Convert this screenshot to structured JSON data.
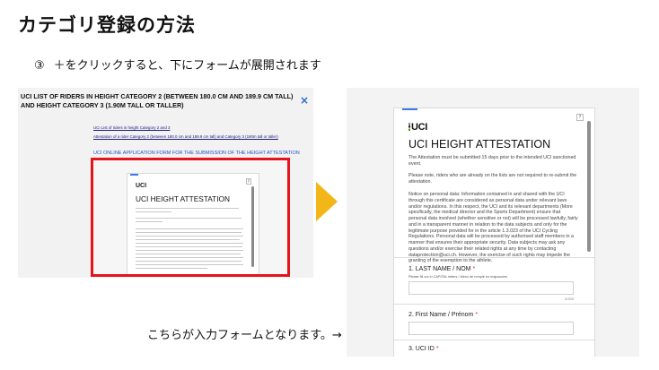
{
  "slide": {
    "title": "カテゴリ登録の方法",
    "step_number": "③",
    "step_text": "＋をクリックすると、下にフォームが展開されます",
    "caption": "こちらが入力フォームとなります。→"
  },
  "left_page": {
    "title": "UCI LIST OF RIDERS IN HEIGHT CATEGORY 2 (BETWEEN 180.0 CM AND 189.9 CM TALL) AND HEIGHT CATEGORY 3 (1.90M TALL OR TALLER)",
    "close_icon": "×",
    "link_1": "UCI List of riders in height Category 2 and 3",
    "link_2": "Attestation of a rider Category 2 (between 180.0 cm and 189.9 cm tall) and Category 3 (190m tall or taller)",
    "apply_link": "UCI ONLINE APPLICATION FORM FOR THE SUBMISSION OF THE HEIGHT ATTESTATION",
    "mini_logo": "UCI",
    "mini_title": "UCI HEIGHT ATTESTATION",
    "mini_help": "?"
  },
  "form": {
    "logo": "UCI",
    "help_label": "?",
    "title": "UCI HEIGHT ATTESTATION",
    "desc_1": "The Attestation must be submitted 15 days prior to the intended UCI sanctioned event.",
    "desc_2": "Please note, riders who are already on the lists are not required to re-submit the attestation.",
    "desc_3": "Notice on personal data: Information contained in and shared with the UCI through this certificate are considered as personal data under relevant laws and/or regulations. In this respect, the UCI and its relevant departments (More specifically, the medical director and the Sports Department) ensure that personal data involved (whether sensitive or not) will be processed lawfully, fairly and in a transparent manner in relation to the data subjects and only for the legitimate purpose provided for in the article 1.3.023 of the UCI Cycling Regulations. Personal data will be processed by authorised staff members in a manner that ensures their appropriate security. Data subjects may ask any questions and/or exercise their related rights at any time by contacting dataprotection@uci.ch. However, the exercise of such rights may impede the granting of the exemption to the athlete.",
    "q1_label": "1. LAST NAME / NOM",
    "q1_hint": "Please fill out in CAPITAL letters / Merci de remplir en majuscules",
    "q1_count": "0/255",
    "q2_label": "2. First Name / Prénom",
    "q3_label": "3. UCI ID",
    "required_mark": "*"
  },
  "colors": {
    "accent": "#3c7be8",
    "highlight_border": "#e4141c",
    "arrow": "#f2b619",
    "required": "#d93025"
  }
}
